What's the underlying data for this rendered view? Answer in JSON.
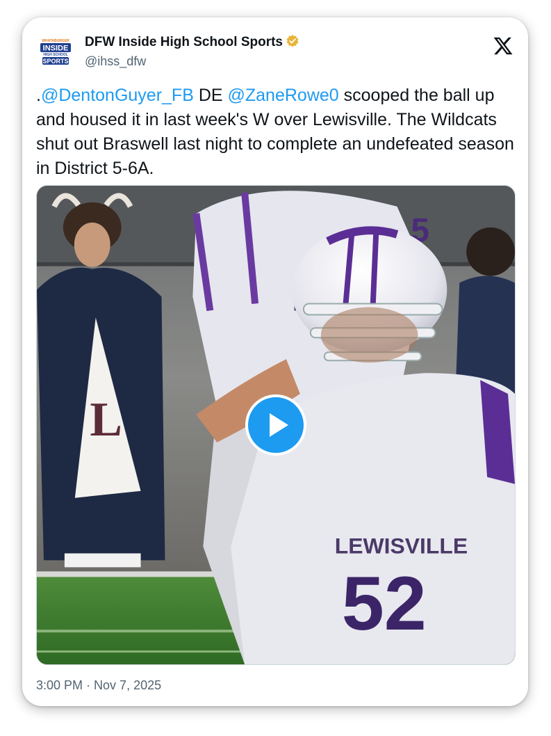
{
  "account": {
    "display_name": "DFW Inside High School Sports",
    "handle": "@ihss_dfw",
    "avatar_text_top": "WHATABURGER",
    "avatar_text_main": "INSIDE",
    "avatar_text_sub": "HIGH SCHOOL",
    "avatar_text_bottom": "SPORTS",
    "verified": true
  },
  "tweet": {
    "prefix": ".",
    "mention_1": "@DentonGuyer_FB",
    "segment_1": " DE ",
    "mention_2": "@ZaneRowe0",
    "segment_2": " scooped the ball up and housed it in last week's W over Lewisville. The Wildcats shut out Braswell last night to complete an undefeated season in District 5-6A."
  },
  "media": {
    "type": "video",
    "jersey_text": "LEWISVILLE",
    "jersey_number": "52",
    "back_number": "5"
  },
  "meta": {
    "time": "3:00 PM",
    "separator": " · ",
    "date": "Nov 7, 2025"
  },
  "colors": {
    "link": "#1d9bf0",
    "text": "#0f1419",
    "secondary": "#536471",
    "verified_gold": "#e8b43a"
  },
  "icons": {
    "brand": "x-logo-icon",
    "verified": "verified-badge-icon",
    "play": "play-icon"
  }
}
